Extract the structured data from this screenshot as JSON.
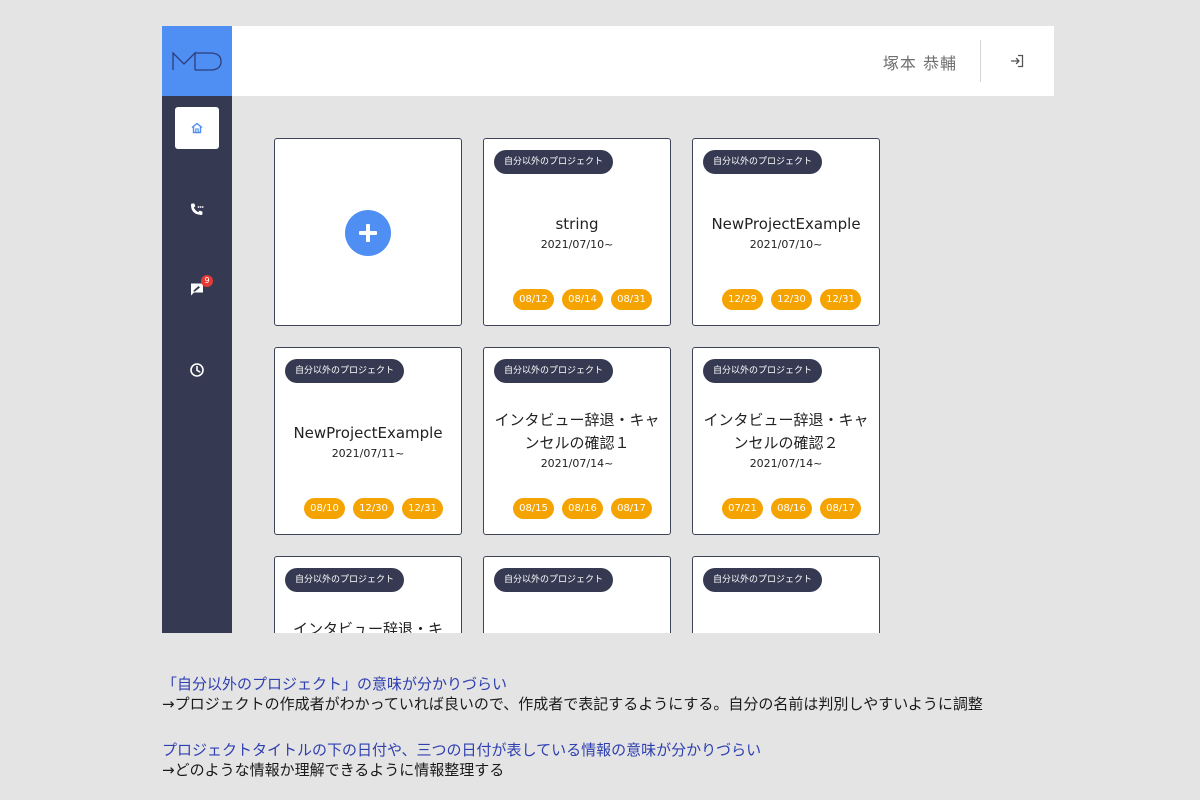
{
  "header": {
    "user_name": "塚本 恭輔"
  },
  "sidebar": {
    "items": [
      {
        "name": "home",
        "icon": "home-icon",
        "active": true
      },
      {
        "name": "calls",
        "icon": "phone-icon",
        "active": false
      },
      {
        "name": "messages",
        "icon": "chat-icon",
        "active": false,
        "badge": "9"
      },
      {
        "name": "history",
        "icon": "clock-icon",
        "active": false
      }
    ]
  },
  "cards": [
    {
      "type": "add"
    },
    {
      "tag": "自分以外のプロジェクト",
      "title": "string",
      "date": "2021/07/10~",
      "chips": [
        "08/12",
        "08/14",
        "08/31"
      ]
    },
    {
      "tag": "自分以外のプロジェクト",
      "title": "NewProjectExample",
      "date": "2021/07/10~",
      "chips": [
        "12/29",
        "12/30",
        "12/31"
      ]
    },
    {
      "tag": "自分以外のプロジェクト",
      "title": "NewProjectExample",
      "date": "2021/07/11~",
      "chips": [
        "08/10",
        "12/30",
        "12/31"
      ]
    },
    {
      "tag": "自分以外のプロジェクト",
      "title": "インタビュー辞退・キャンセルの確認１",
      "date": "2021/07/14~",
      "chips": [
        "08/15",
        "08/16",
        "08/17"
      ]
    },
    {
      "tag": "自分以外のプロジェクト",
      "title": "インタビュー辞退・キャンセルの確認２",
      "date": "2021/07/14~",
      "chips": [
        "07/21",
        "08/16",
        "08/17"
      ]
    },
    {
      "tag": "自分以外のプロジェクト",
      "title": "インタビュー辞退・キ",
      "date": "",
      "chips": []
    },
    {
      "tag": "自分以外のプロジェクト",
      "title": "",
      "date": "",
      "chips": []
    },
    {
      "tag": "自分以外のプロジェクト",
      "title": "",
      "date": "",
      "chips": []
    }
  ],
  "notes": [
    {
      "title": "「自分以外のプロジェクト」の意味が分かりづらい",
      "body": "→プロジェクトの作成者がわかっていれば良いので、作成者で表記するようにする。自分の名前は判別しやすいように調整"
    },
    {
      "title": "プロジェクトタイトルの下の日付や、三つの日付が表している情報の意味が分かりづらい",
      "body": "→どのような情報か理解できるように情報整理する"
    }
  ],
  "colors": {
    "sidebar": "#353a52",
    "accent": "#4f8ef2",
    "chip": "#f5a300",
    "note_title": "#2e3fb0",
    "badge": "#e53935"
  }
}
